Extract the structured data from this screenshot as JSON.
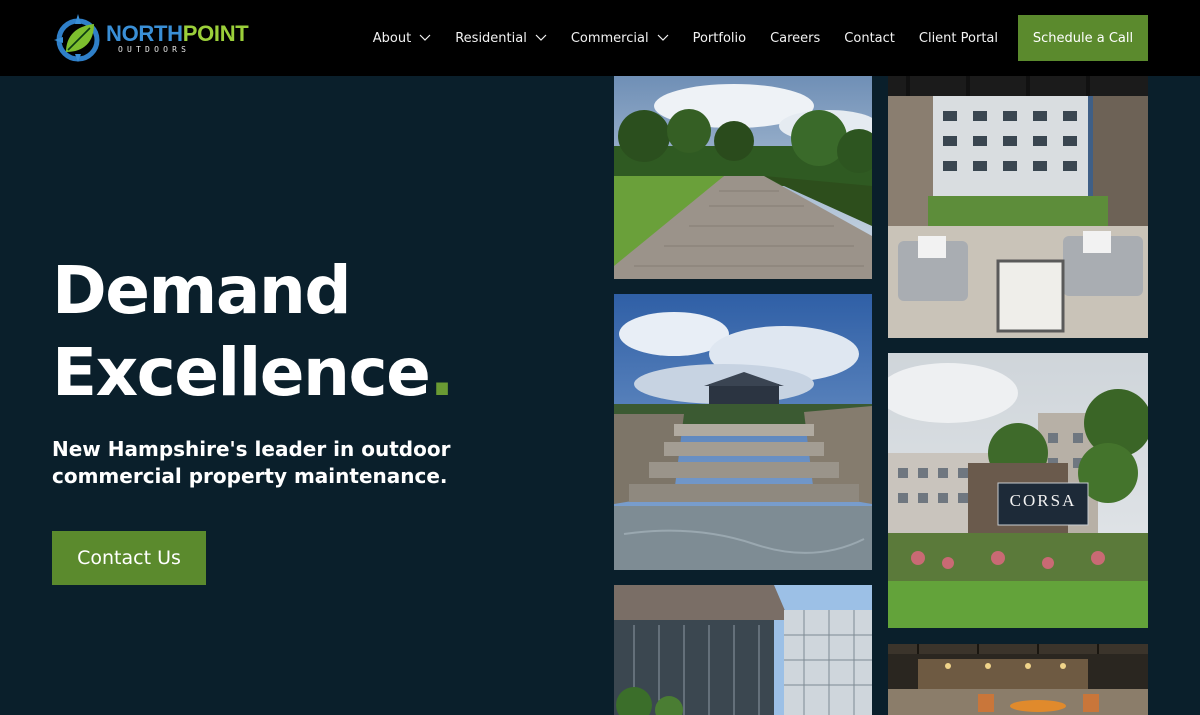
{
  "header": {
    "logo": {
      "name_part1": "NORTH",
      "name_part2": "POINT",
      "tagline": "OUTDOORS"
    },
    "nav": [
      {
        "label": "About",
        "has_dropdown": true
      },
      {
        "label": "Residential",
        "has_dropdown": true
      },
      {
        "label": "Commercial",
        "has_dropdown": true
      },
      {
        "label": "Portfolio",
        "has_dropdown": false
      },
      {
        "label": "Careers",
        "has_dropdown": false
      },
      {
        "label": "Contact",
        "has_dropdown": false
      },
      {
        "label": "Client Portal",
        "has_dropdown": false
      }
    ],
    "cta_label": "Schedule a Call"
  },
  "hero": {
    "title_line1": "Demand",
    "title_line2": "Excellence",
    "title_dot": ".",
    "subtitle": "New Hampshire's leader in outdoor commercial property maintenance.",
    "cta_label": "Contact Us"
  },
  "gallery": {
    "corsa_sign": "CORSA",
    "tiles": [
      {
        "icon": "paver-walkway-photo"
      },
      {
        "icon": "courtyard-lounge-photo"
      },
      {
        "icon": "stone-steps-photo"
      },
      {
        "icon": "corsa-sign-photo"
      },
      {
        "icon": "commercial-building-photo"
      },
      {
        "icon": "outdoor-kitchen-photo"
      }
    ]
  },
  "colors": {
    "background": "#0a1f2b",
    "header": "#000000",
    "accent_green": "#5b8a2d",
    "logo_blue": "#3a8fd6",
    "logo_green": "#9bcf3a"
  }
}
